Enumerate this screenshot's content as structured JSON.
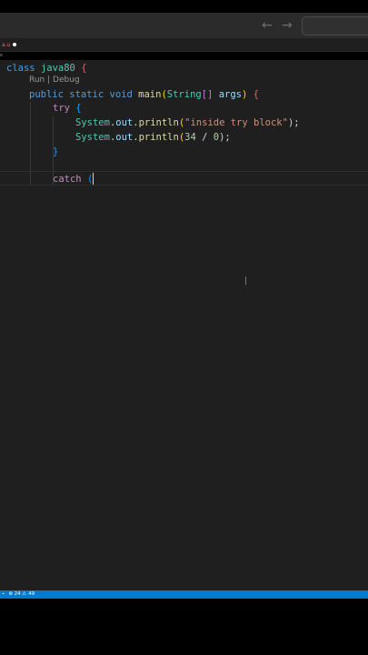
{
  "titlebar": {
    "back_icon": "←",
    "forward_icon": "→"
  },
  "tab": {
    "label": "a.u",
    "modified_indicator": "dot"
  },
  "breadcrumb": "e",
  "codelens": "Run | Debug",
  "code": {
    "line1_kw": "class",
    "line1_name": "java80",
    "line1_brace": "{",
    "line3_public": "public",
    "line3_static": "static",
    "line3_void": "void",
    "line3_main": "main",
    "line3_open": "(",
    "line3_string": "String",
    "line3_arr": "[]",
    "line3_args": "args",
    "line3_close": ")",
    "line3_brace": "{",
    "line4_try": "try",
    "line4_brace": "{",
    "line5_system": "System",
    "line5_out": "out",
    "line5_println": "println",
    "line5_open": "(",
    "line5_str": "\"inside try block\"",
    "line5_close": ");",
    "line6_system": "System",
    "line6_out": "out",
    "line6_println": "println",
    "line6_open": "(",
    "line6_num1": "34",
    "line6_op": " / ",
    "line6_num2": "0",
    "line6_close": ");",
    "line7_brace": "}",
    "line8_catch": "catch",
    "line8_paren": "("
  },
  "statusbar": {
    "remote": "⌁",
    "problems": "⊗ 24 ⚠ 49"
  }
}
